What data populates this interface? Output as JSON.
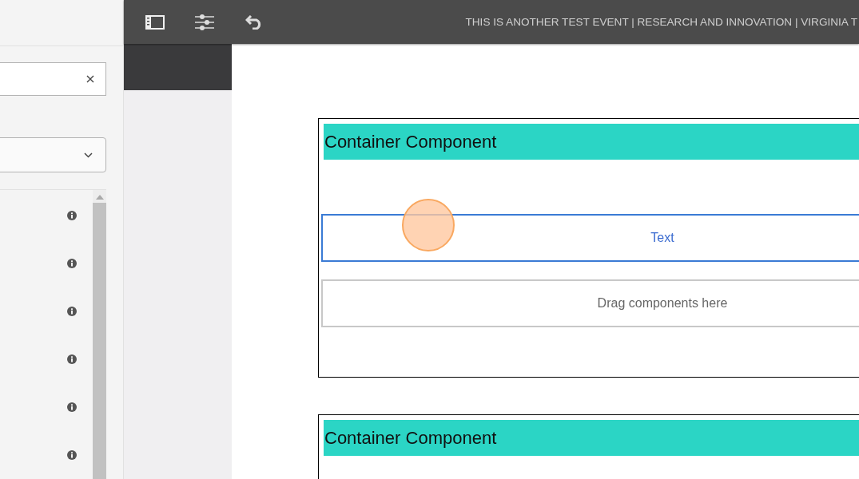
{
  "toolbar": {
    "title": "THIS IS ANOTHER TEST EVENT | RESEARCH AND INNOVATION | VIRGINIA T"
  },
  "sidebar": {
    "rows": [
      {
        "kind": "info"
      },
      {
        "kind": "info"
      },
      {
        "kind": "info"
      },
      {
        "kind": "info"
      },
      {
        "kind": "info"
      },
      {
        "kind": "info"
      }
    ]
  },
  "canvas": {
    "containers": [
      {
        "title": "Container Component",
        "items": [
          {
            "kind": "component",
            "label": "Text",
            "selected": true
          },
          {
            "kind": "dropzone",
            "label": "Drag components here",
            "selected": false
          }
        ]
      },
      {
        "title": "Container Component"
      }
    ]
  }
}
